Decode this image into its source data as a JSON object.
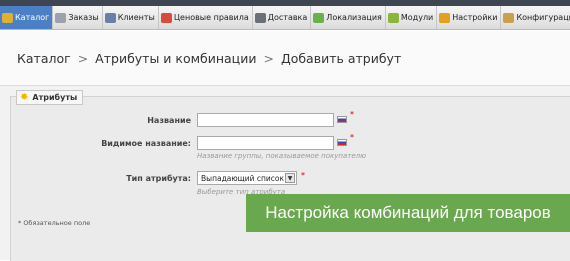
{
  "menu": {
    "tabs": [
      {
        "label": "Каталог",
        "icon": "catalog-icon",
        "color": "#e0b030",
        "active": true
      },
      {
        "label": "Заказы",
        "icon": "orders-icon",
        "color": "#9aa2aa",
        "active": false
      },
      {
        "label": "Клиенты",
        "icon": "customers-icon",
        "color": "#6a7fa8",
        "active": false
      },
      {
        "label": "Ценовые правила",
        "icon": "price-rules-icon",
        "color": "#d84a3c",
        "active": false
      },
      {
        "label": "Доставка",
        "icon": "shipping-icon",
        "color": "#6a6f78",
        "active": false
      },
      {
        "label": "Локализация",
        "icon": "localization-icon",
        "color": "#6ab04c",
        "active": false
      },
      {
        "label": "Модули",
        "icon": "modules-icon",
        "color": "#8bb63a",
        "active": false
      },
      {
        "label": "Настройки",
        "icon": "preferences-icon",
        "color": "#e0a020",
        "active": false
      },
      {
        "label": "Конфигурация",
        "icon": "configuration-icon",
        "color": "#c8a050",
        "active": false
      }
    ]
  },
  "breadcrumb": {
    "item1": "Каталог",
    "item2": "Атрибуты и комбинации",
    "item3": "Добавить атрибут",
    "separator": ">"
  },
  "form": {
    "legend": "Атрибуты",
    "name_label": "Название",
    "name_value": "",
    "public_name_label": "Видимое название:",
    "public_name_value": "",
    "public_name_hint": "Название группы, показываемое покупателю",
    "type_label": "Тип атрибута:",
    "type_value": "Выпадающий список",
    "type_hint": "Выберите тип атрибута",
    "required_mark": "*",
    "required_note": "* Обязательное поле"
  },
  "banner": {
    "text": "Настройка комбинаций для товаров",
    "color": "#6aa84f"
  }
}
